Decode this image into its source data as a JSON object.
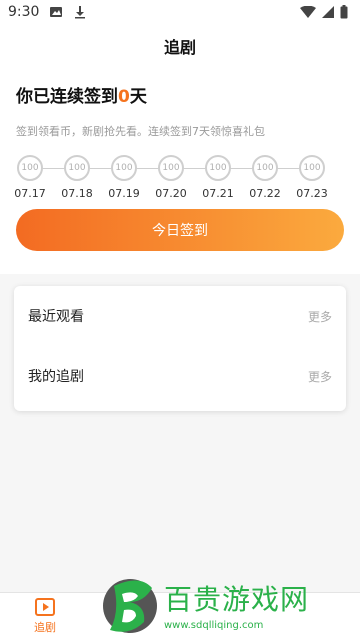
{
  "status_bar": {
    "time": "9:30"
  },
  "header": {
    "title": "追剧"
  },
  "checkin": {
    "title_prefix": "你已连续签到",
    "streak_days": "0",
    "title_suffix": "天",
    "description": "签到领看币，新剧抢先看。连续签到7天领惊喜礼包",
    "days": [
      {
        "coin": "100",
        "date": "07.17"
      },
      {
        "coin": "100",
        "date": "07.18"
      },
      {
        "coin": "100",
        "date": "07.19"
      },
      {
        "coin": "100",
        "date": "07.20"
      },
      {
        "coin": "100",
        "date": "07.21"
      },
      {
        "coin": "100",
        "date": "07.22"
      },
      {
        "coin": "100",
        "date": "07.23"
      }
    ],
    "button_label": "今日签到"
  },
  "lists": [
    {
      "title": "最近观看",
      "more": "更多"
    },
    {
      "title": "我的追剧",
      "more": "更多"
    }
  ],
  "bottom_nav": {
    "items": [
      {
        "label": "追剧",
        "icon": "play-icon"
      }
    ]
  },
  "watermark": {
    "cn": "百贵游戏网",
    "url": "www.sdqlliqing.com"
  },
  "colors": {
    "accent": "#f5731e",
    "gradient_start": "#f36b22",
    "gradient_end": "#fbaa3e"
  }
}
